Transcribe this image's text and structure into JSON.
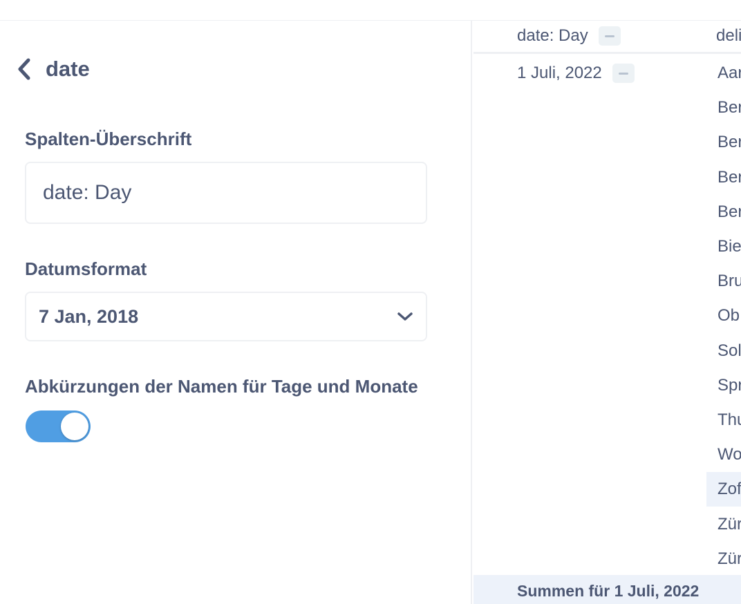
{
  "panel": {
    "back_title": "date",
    "column_header_label": "Spalten-Überschrift",
    "column_header_value": "date: Day",
    "date_format_label": "Datumsformat",
    "date_format_value": "7 Jan, 2018",
    "abbreviate_label": "Abkürzungen der Namen für Tage und Monate",
    "abbreviate_enabled": true,
    "accent_color": "#509ee3"
  },
  "table": {
    "headers": [
      "date: Day",
      "deli"
    ],
    "date_value": "1 Juli, 2022",
    "rows": [
      "Aar",
      "Ber",
      "Ber",
      "Ber",
      "Ber",
      "Bie",
      "Bru",
      "Ob",
      "Sol",
      "Spr",
      "Thu",
      "Wo",
      "Zof",
      "Zür",
      "Zür"
    ],
    "highlighted_row_index": 12,
    "totals_label": "Summen für 1 Juli, 2022"
  },
  "icons": {
    "back": "chevron-left-icon",
    "dropdown": "chevron-down-icon",
    "collapse": "minus-icon"
  }
}
